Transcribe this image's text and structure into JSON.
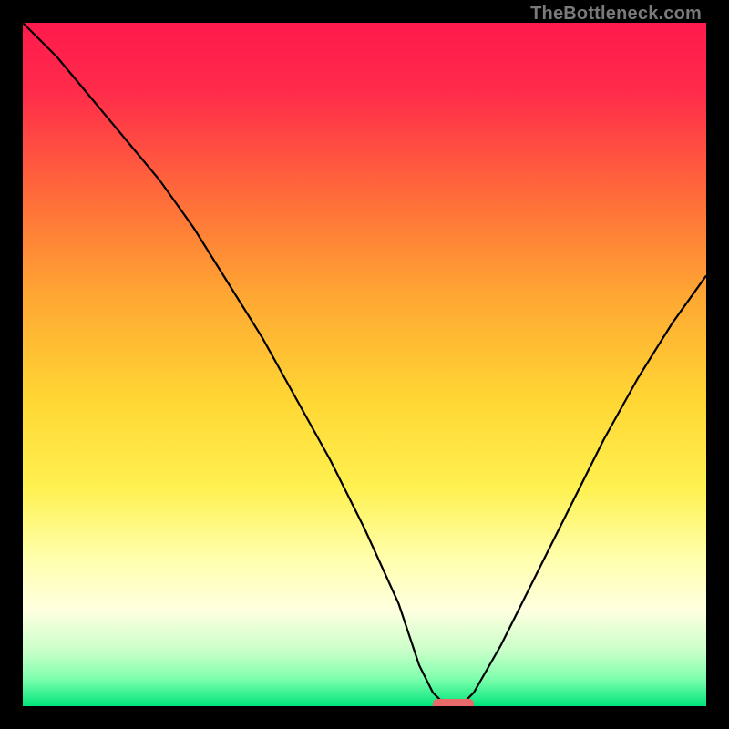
{
  "watermark": "TheBottleneck.com",
  "chart_data": {
    "type": "line",
    "title": "",
    "xlabel": "",
    "ylabel": "",
    "xlim": [
      0,
      100
    ],
    "ylim": [
      0,
      100
    ],
    "grid": false,
    "background_gradient": {
      "stops": [
        {
          "pos": 0.0,
          "color": "#ff1a4d"
        },
        {
          "pos": 0.1,
          "color": "#ff2b4a"
        },
        {
          "pos": 0.25,
          "color": "#ff6a3a"
        },
        {
          "pos": 0.4,
          "color": "#ffa733"
        },
        {
          "pos": 0.55,
          "color": "#ffd633"
        },
        {
          "pos": 0.68,
          "color": "#fff150"
        },
        {
          "pos": 0.78,
          "color": "#ffffaa"
        },
        {
          "pos": 0.86,
          "color": "#ffffe0"
        },
        {
          "pos": 0.92,
          "color": "#c8ffc8"
        },
        {
          "pos": 0.96,
          "color": "#7dffad"
        },
        {
          "pos": 1.0,
          "color": "#00e57a"
        }
      ]
    },
    "series": [
      {
        "name": "bottleneck-curve",
        "color": "#000000",
        "x": [
          0,
          5,
          10,
          15,
          20,
          25,
          30,
          35,
          40,
          45,
          50,
          55,
          58,
          60,
          62,
          64,
          66,
          70,
          75,
          80,
          85,
          90,
          95,
          100
        ],
        "y": [
          100,
          95,
          89,
          83,
          77,
          70,
          62,
          54,
          45,
          36,
          26,
          15,
          6,
          2,
          0,
          0,
          2,
          9,
          19,
          29,
          39,
          48,
          56,
          63
        ]
      }
    ],
    "marker": {
      "name": "optimum-marker",
      "x": 63,
      "y": 0,
      "width": 6,
      "color": "#e96a6a",
      "shape": "pill"
    }
  }
}
